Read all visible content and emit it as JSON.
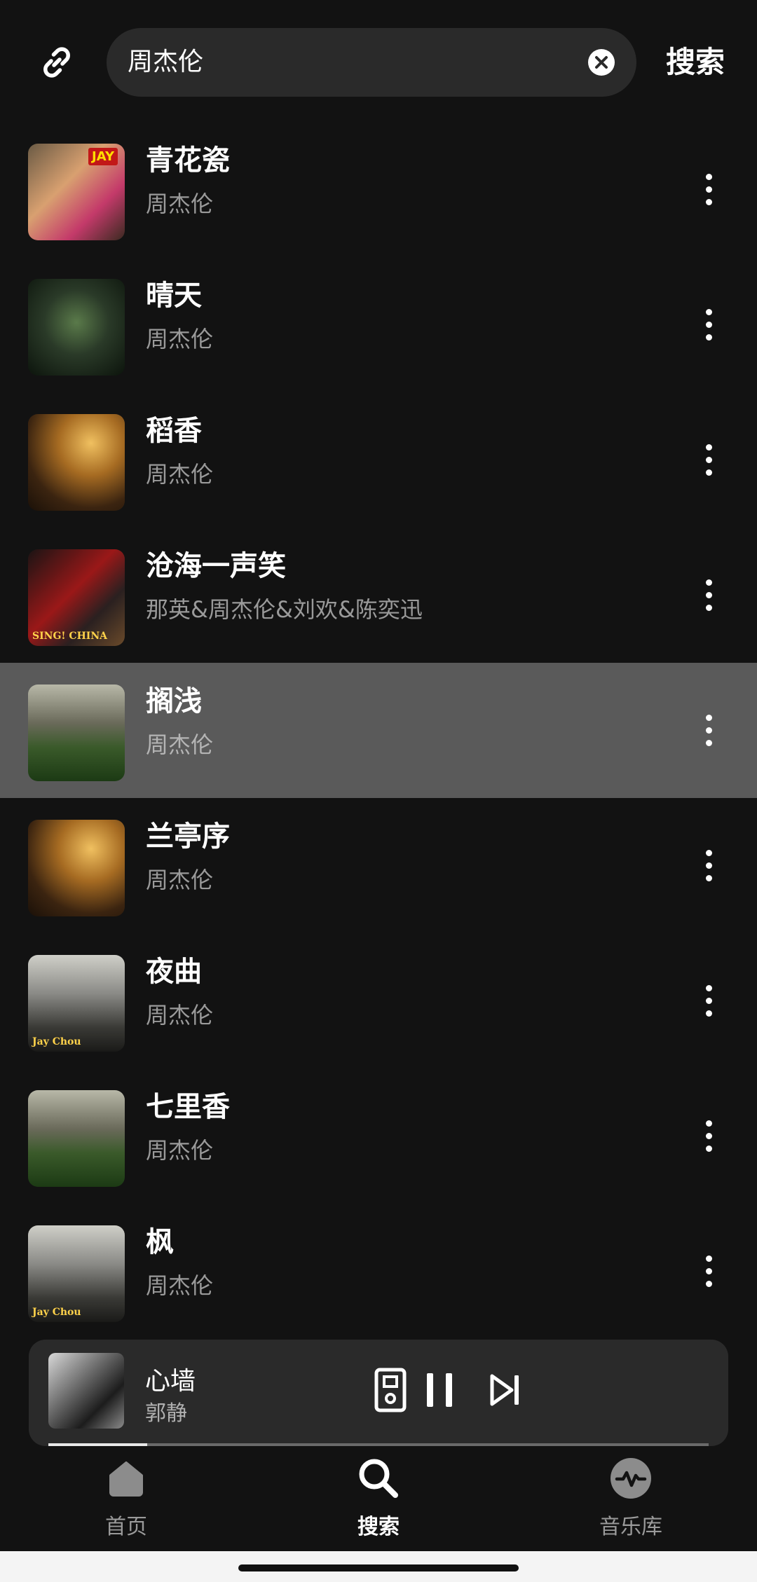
{
  "search": {
    "query": "周杰伦",
    "action_label": "搜索"
  },
  "songs": [
    {
      "title": "青花瓷",
      "artist": "周杰伦",
      "cover": "c-pink",
      "badge": "JAY",
      "caption": ""
    },
    {
      "title": "晴天",
      "artist": "周杰伦",
      "cover": "c-green",
      "badge": "",
      "caption": ""
    },
    {
      "title": "稻香",
      "artist": "周杰伦",
      "cover": "c-warm",
      "badge": "",
      "caption": ""
    },
    {
      "title": "沧海一声笑",
      "artist": "那英&周杰伦&刘欢&陈奕迅",
      "cover": "c-red",
      "badge": "",
      "caption": "SING! CHINA"
    },
    {
      "title": "搁浅",
      "artist": "周杰伦",
      "cover": "c-field",
      "badge": "",
      "caption": ""
    },
    {
      "title": "兰亭序",
      "artist": "周杰伦",
      "cover": "c-warm",
      "badge": "",
      "caption": ""
    },
    {
      "title": "夜曲",
      "artist": "周杰伦",
      "cover": "c-gray",
      "badge": "",
      "caption": "Jay Chou"
    },
    {
      "title": "七里香",
      "artist": "周杰伦",
      "cover": "c-field",
      "badge": "",
      "caption": ""
    },
    {
      "title": "枫",
      "artist": "周杰伦",
      "cover": "c-gray",
      "badge": "",
      "caption": "Jay Chou"
    }
  ],
  "highlighted_index": 4,
  "player": {
    "title": "心墙",
    "artist": "郭静",
    "progress": 0.15
  },
  "nav": {
    "items": [
      {
        "label": "首页",
        "icon": "home-icon"
      },
      {
        "label": "搜索",
        "icon": "search-icon"
      },
      {
        "label": "音乐库",
        "icon": "library-icon"
      }
    ],
    "selected": 1
  }
}
